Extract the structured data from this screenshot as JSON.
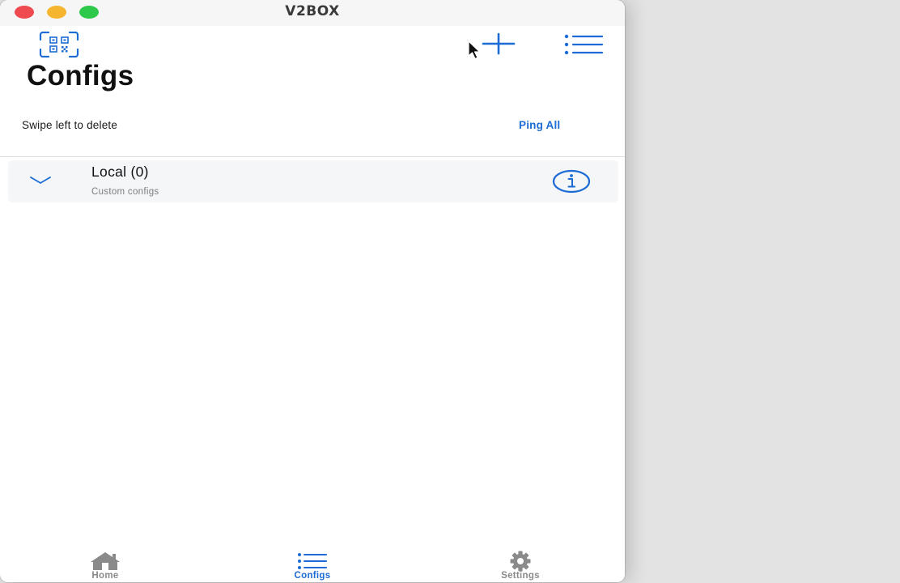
{
  "window": {
    "title": "V2BOX"
  },
  "header": {
    "qr_button_icon": "qr-scan-icon",
    "add_button_icon": "plus-icon",
    "menu_button_icon": "list-icon",
    "title": "Configs"
  },
  "toolbar": {
    "hint": "Swipe left to delete",
    "ping_all_label": "Ping All"
  },
  "groups": [
    {
      "name": "Local (0)",
      "subtitle": "Custom configs",
      "expand_icon": "chevron-down-icon",
      "info_icon": "info-icon"
    }
  ],
  "tabbar": {
    "tabs": [
      {
        "label": "Home",
        "icon": "house-icon",
        "active": false
      },
      {
        "label": "Configs",
        "icon": "list-icon",
        "active": true
      },
      {
        "label": "Settings",
        "icon": "gear-icon",
        "active": false
      }
    ]
  },
  "colors": {
    "accent": "#1d6bd4",
    "inactive_tab": "#8a8a8a",
    "close": "#ef4a4f",
    "minimize": "#f5b52f",
    "zoom": "#2ec84a"
  }
}
